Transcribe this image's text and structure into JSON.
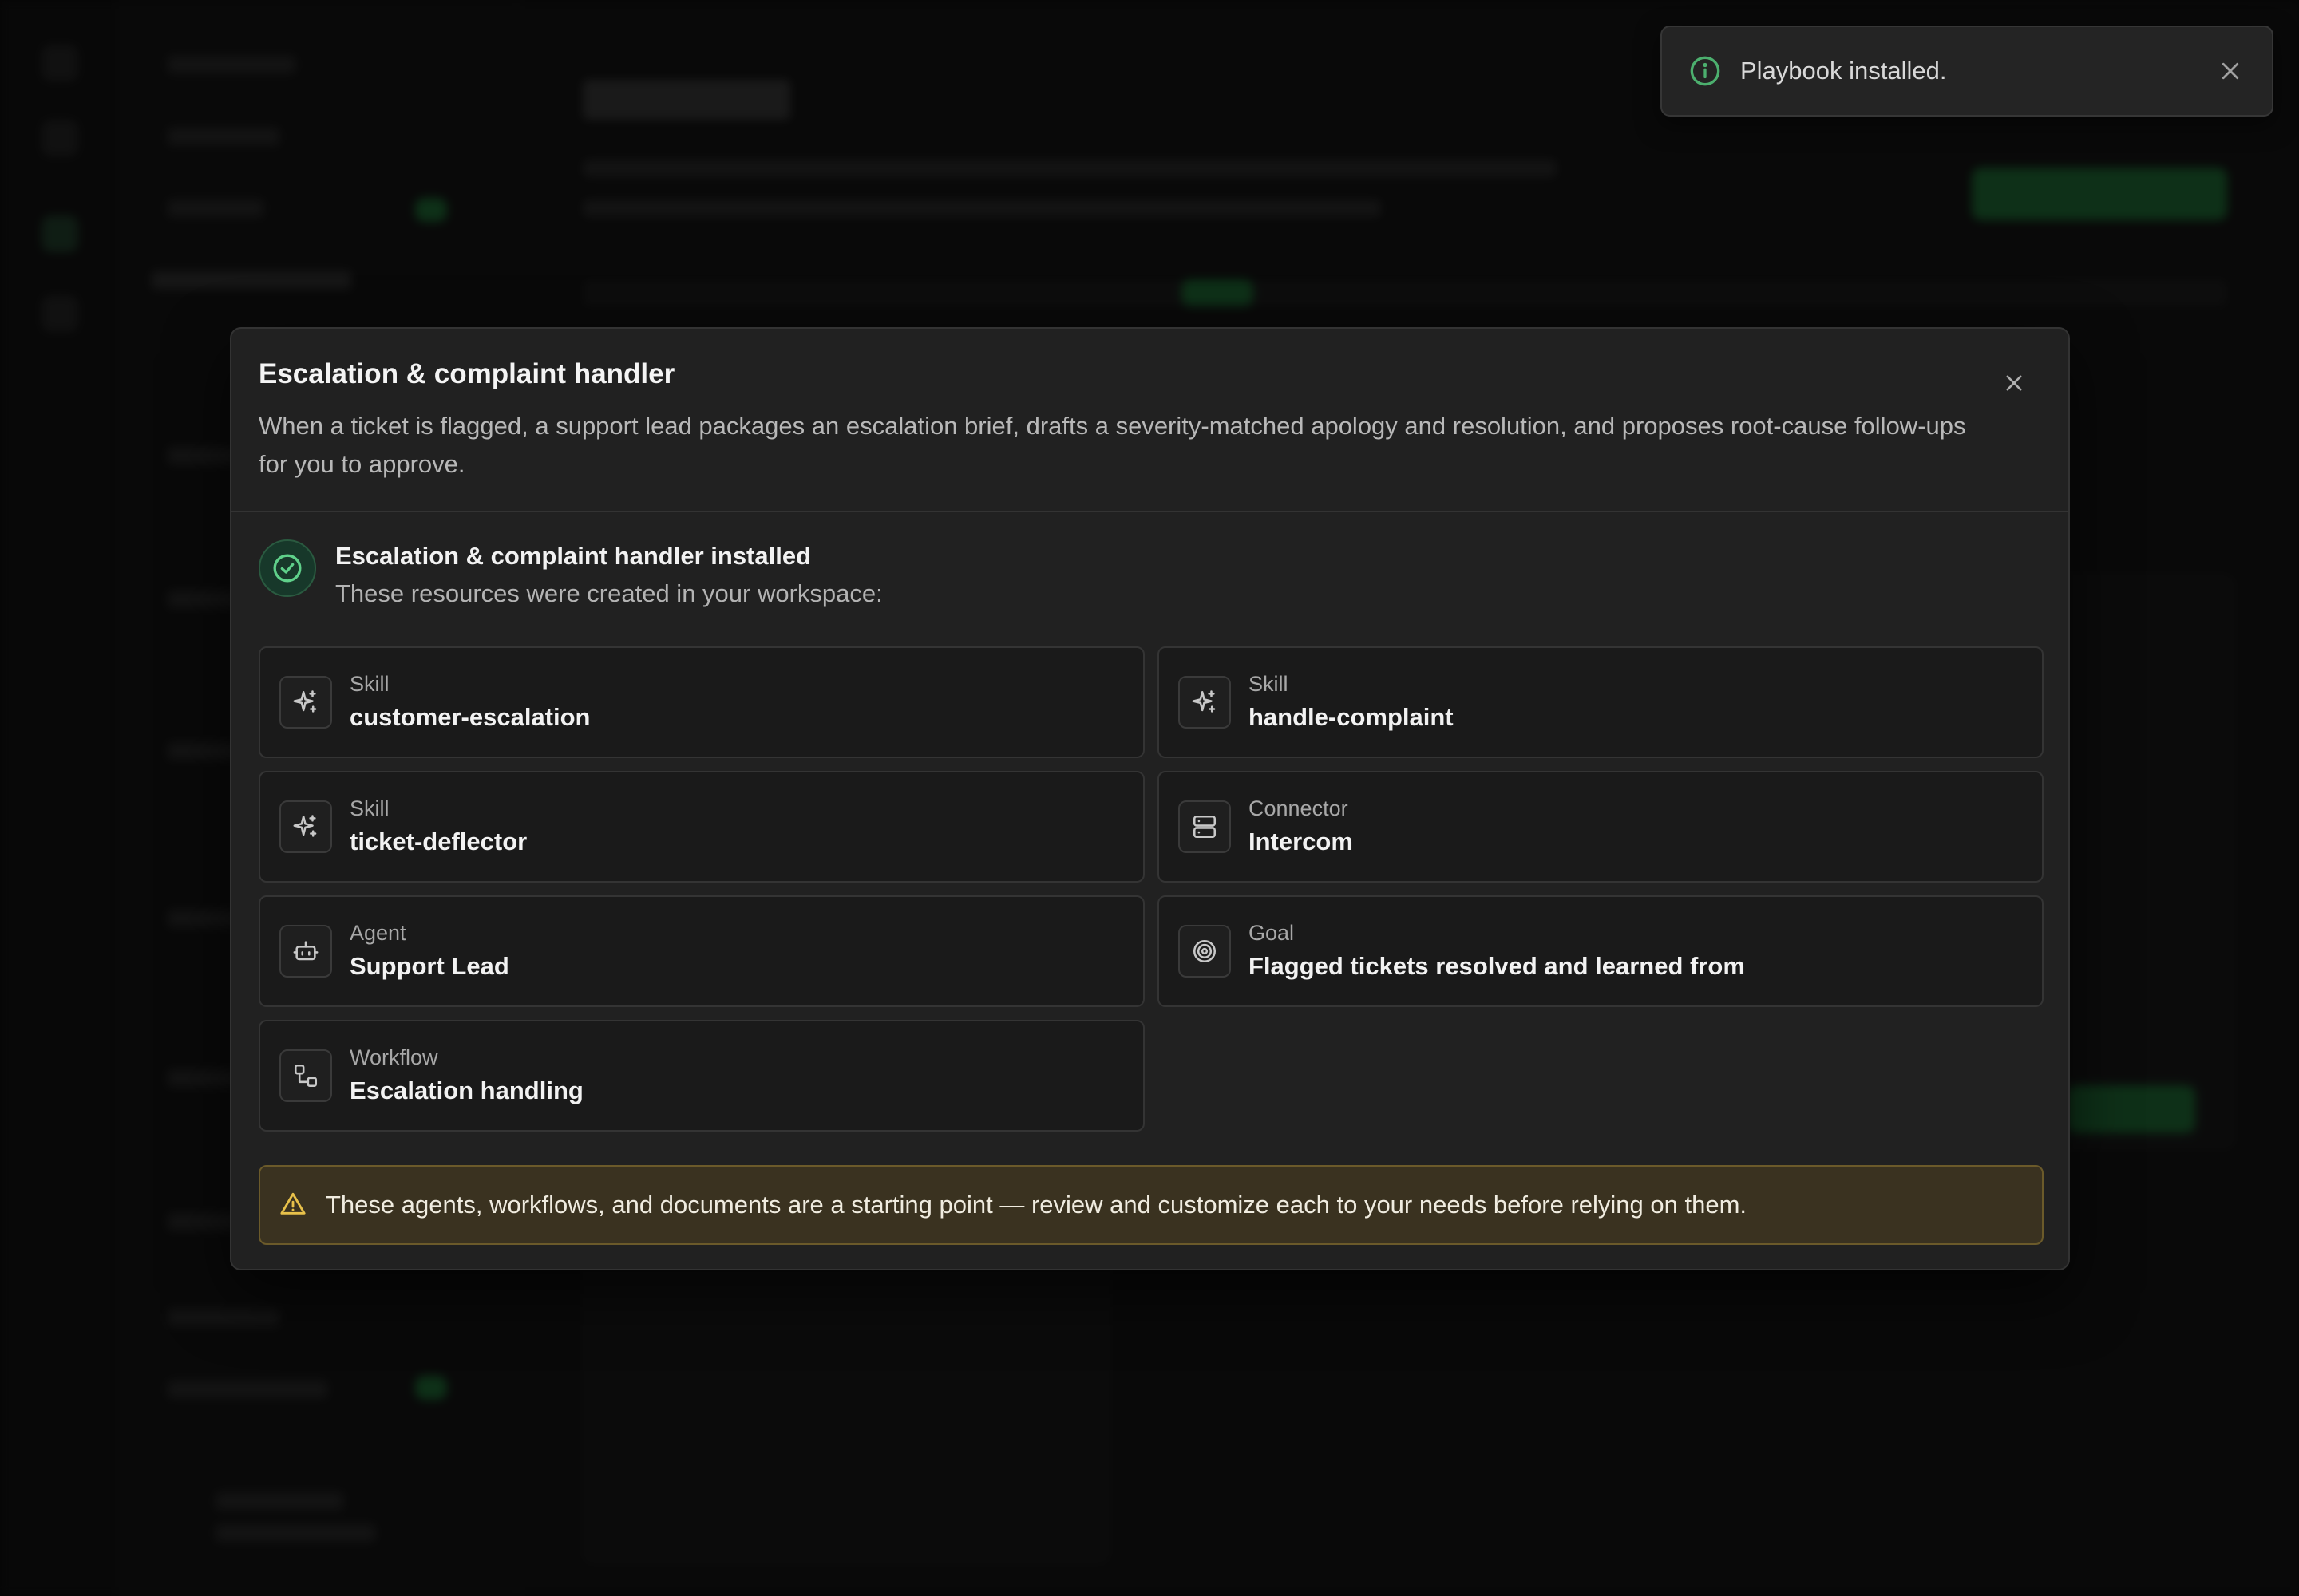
{
  "toast": {
    "message": "Playbook installed.",
    "icon": "info-icon",
    "accent": "#4caf6e"
  },
  "modal": {
    "title": "Escalation & complaint handler",
    "description": "When a ticket is flagged, a support lead packages an escalation brief, drafts a severity-matched apology and resolution, and proposes root-cause follow-ups for you to approve.",
    "installed": {
      "title": "Escalation & complaint handler installed",
      "subtitle": "These resources were created in your workspace:"
    },
    "resources": [
      {
        "kind": "Skill",
        "name": "customer-escalation",
        "icon": "sparkle-icon"
      },
      {
        "kind": "Skill",
        "name": "handle-complaint",
        "icon": "sparkle-icon"
      },
      {
        "kind": "Skill",
        "name": "ticket-deflector",
        "icon": "sparkle-icon"
      },
      {
        "kind": "Connector",
        "name": "Intercom",
        "icon": "server-icon"
      },
      {
        "kind": "Agent",
        "name": "Support Lead",
        "icon": "bot-icon"
      },
      {
        "kind": "Goal",
        "name": "Flagged tickets resolved and learned from",
        "icon": "target-icon"
      },
      {
        "kind": "Workflow",
        "name": "Escalation handling",
        "icon": "workflow-icon"
      }
    ],
    "warning": "These agents, workflows, and documents are a starting point — review and customize each to your needs before relying on them."
  },
  "colors": {
    "success": "#4caf6e",
    "warning": "#e8c14a",
    "background": "#212121"
  }
}
